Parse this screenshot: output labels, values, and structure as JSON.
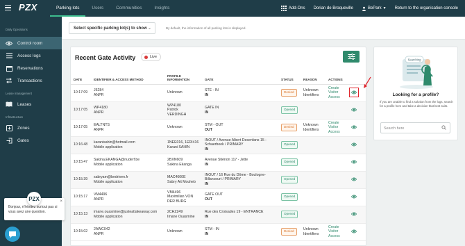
{
  "topbar": {
    "logo": "PZX",
    "tabs": [
      {
        "label": "Parking lots",
        "active": true
      },
      {
        "label": "Users",
        "active": false
      },
      {
        "label": "Communities",
        "active": false
      },
      {
        "label": "Insights",
        "active": false
      }
    ],
    "addons": "Add-Ons",
    "user": "Dorian de Broqueville",
    "org": "BePark",
    "console_link": "Return to the organisation console"
  },
  "sidebar": {
    "section_operations": "Daily Operations",
    "operations": [
      {
        "label": "Control room",
        "icon": "eye-icon",
        "active": true
      },
      {
        "label": "Access logs",
        "icon": "list-icon",
        "active": false
      },
      {
        "label": "Reservations",
        "icon": "calendar-icon",
        "active": false
      },
      {
        "label": "Transactions",
        "icon": "transfer-icon",
        "active": false
      }
    ],
    "section_lease": "Lease management",
    "lease": [
      {
        "label": "Leases",
        "icon": "book-icon",
        "active": false
      }
    ],
    "section_infra": "Infrastructure",
    "infra": [
      {
        "label": "Zones",
        "icon": "zones-icon",
        "active": false
      },
      {
        "label": "Gates",
        "icon": "gate-icon",
        "active": false
      }
    ]
  },
  "chat": {
    "message": "Bonjour, n'hésitez surtout pas si vous avez une question.",
    "close": "×",
    "avatar_logo": "PZX"
  },
  "filter": {
    "select_label": "Select specific parking lot(s) to show",
    "note": "By default, the information of all parking lots is displayed."
  },
  "activity": {
    "title": "Recent Gate Activity",
    "live_label": "Live",
    "columns": [
      "DATE",
      "IDENTIFIER & ACCESS METHOD",
      "PROFILE INFORMATION",
      "GATE",
      "STATUS",
      "REASON",
      "ACTIONS"
    ],
    "rows": [
      {
        "date": "10:17:09",
        "id": "J5284",
        "method": "ANPR",
        "profile": [
          "Unknown"
        ],
        "gate": "STE - IN",
        "dir": "IN",
        "status": "Denied",
        "reason": "Unknown Identifiers",
        "action": "Create Visitor Access",
        "highlight": true
      },
      {
        "date": "10:17:05",
        "id": "WP4180",
        "method": "ANPR",
        "profile": [
          "WP4180",
          "Patrick",
          "VERDINGH"
        ],
        "gate": "GATE IN",
        "dir": "IN",
        "status": "Opened",
        "reason": "",
        "action": "",
        "highlight": false
      },
      {
        "date": "10:17:05",
        "id": "EALTNTS",
        "method": "ANPR",
        "profile": [
          "Unknown"
        ],
        "gate": "STM - OUT",
        "dir": "OUT",
        "status": "Denied",
        "reason": "Unknown Identifiers",
        "action": "Create Visitor Access",
        "highlight": false
      },
      {
        "date": "10:16:48",
        "id": "karanisahin@hotmail.com",
        "method": "Mobile application",
        "profile": [
          "1NEE016, 1ERI416",
          "Karani SAHIN"
        ],
        "gate": "INOUT / Avenue Albert Desenfans 15 - Schaerbeek / PRIMARY",
        "dir": "IN",
        "status": "Opened",
        "reason": "",
        "action": "",
        "highlight": false
      },
      {
        "date": "10:15:47",
        "id": "Sakina.EKANGA@nuderf.be",
        "method": "Mobile application",
        "profile": [
          "2BXN609",
          "Sakina Ekanga"
        ],
        "gate": "Avenue Stiénon 117 - Jette",
        "dir": "IN",
        "status": "Opened",
        "reason": "",
        "action": "",
        "highlight": false
      },
      {
        "date": "10:15:39",
        "id": "sabryam@bedriven.fr",
        "method": "Mobile application",
        "profile": [
          "MAC4600E",
          "Sabry Ait Mouheb"
        ],
        "gate": "INOUT / 16 Rue du Dôme - Boulogne-Billancourt / PRIMARY",
        "dir": "IN",
        "status": "Opened",
        "reason": "",
        "action": "",
        "highlight": false
      },
      {
        "date": "10:15:17",
        "id": "VM4496",
        "method": "ANPR",
        "profile": [
          "VM4496",
          "Maximilian VON",
          "DER BURG"
        ],
        "gate": "GATE OUT",
        "dir": "OUT",
        "status": "Opened",
        "reason": "",
        "action": "",
        "highlight": false
      },
      {
        "date": "10:15:13",
        "id": "imane.ouasmine@justeattakeaway.com",
        "method": "Mobile application",
        "profile": [
          "2CHZ249",
          "Imane Ouasmine"
        ],
        "gate": "Rue des Croisades 19 - ENTRANCE",
        "dir": "IN",
        "status": "Opened",
        "reason": "",
        "action": "",
        "highlight": false
      },
      {
        "date": "10:15:02",
        "id": "2AWC042",
        "method": "ANPR",
        "profile": [
          "Unknown"
        ],
        "gate": "STM - IN",
        "dir": "IN",
        "status": "Denied",
        "reason": "Unknown Identifiers",
        "action": "Create Visitor Access",
        "highlight": false
      }
    ]
  },
  "profile_card": {
    "title": "Looking for a profile?",
    "description": "If you are unable to find a solution from the logs, search for a profile here and take a decision that best suits.",
    "search_placeholder": "Search here",
    "illustration_label": "Searching"
  },
  "colors": {
    "primary": "#1f3d48",
    "accent": "#2f8a6c",
    "denied": "#d9762c",
    "highlight": "#e0262d"
  }
}
